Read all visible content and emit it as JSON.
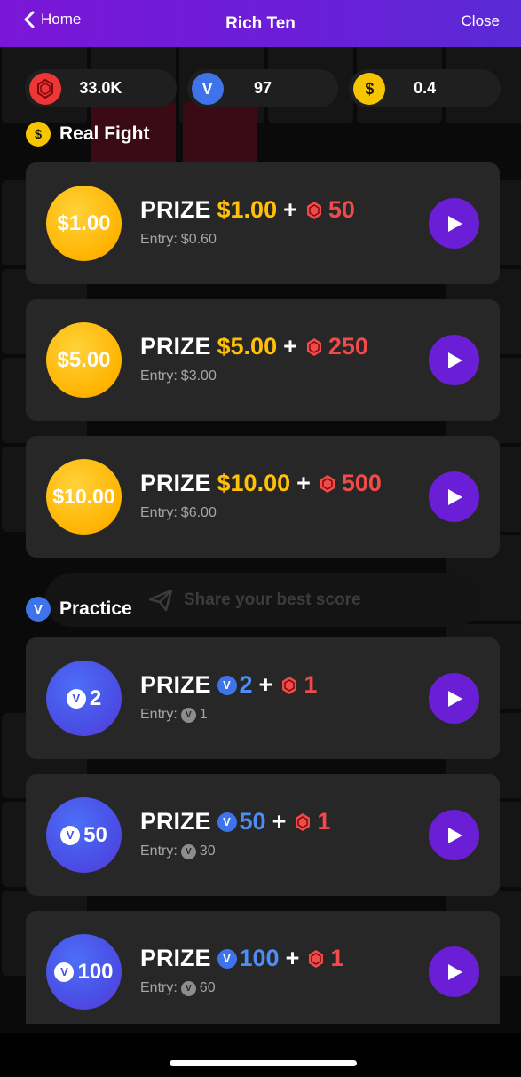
{
  "nav": {
    "back_label": "Home",
    "title": "Rich Ten",
    "close_label": "Close"
  },
  "stats": [
    {
      "icon": "gem-icon",
      "value": "33.0K"
    },
    {
      "icon": "v-coin-icon",
      "icon_text": "V",
      "value": "97"
    },
    {
      "icon": "dollar-coin-icon",
      "icon_text": "$",
      "value": "0.4"
    }
  ],
  "real_fight": {
    "badge": "$",
    "title": "Real Fight",
    "cards": [
      {
        "coin_label": "$1.00",
        "prize_label": "PRIZE",
        "prize_amount": "$1.00",
        "plus": "+",
        "gem_amount": "50",
        "entry_label": "Entry:",
        "entry_value": "$0.60"
      },
      {
        "coin_label": "$5.00",
        "prize_label": "PRIZE",
        "prize_amount": "$5.00",
        "plus": "+",
        "gem_amount": "250",
        "entry_label": "Entry:",
        "entry_value": "$3.00"
      },
      {
        "coin_label": "$10.00",
        "prize_label": "PRIZE",
        "prize_amount": "$10.00",
        "plus": "+",
        "gem_amount": "500",
        "entry_label": "Entry:",
        "entry_value": "$6.00"
      }
    ]
  },
  "share": {
    "label": "Share your best score"
  },
  "practice": {
    "badge": "V",
    "title": "Practice",
    "cards": [
      {
        "coin_label": "2",
        "prize_label": "PRIZE",
        "prize_amount": "2",
        "plus": "+",
        "gem_amount": "1",
        "entry_label": "Entry:",
        "entry_value": "1"
      },
      {
        "coin_label": "50",
        "prize_label": "PRIZE",
        "prize_amount": "50",
        "plus": "+",
        "gem_amount": "1",
        "entry_label": "Entry:",
        "entry_value": "30"
      },
      {
        "coin_label": "100",
        "prize_label": "PRIZE",
        "prize_amount": "100",
        "plus": "+",
        "gem_amount": "1",
        "entry_label": "Entry:",
        "entry_value": "60"
      }
    ]
  },
  "colors": {
    "nav_purple": "#6a1fd6",
    "gold": "#ffc107",
    "gem_red": "#f04a4a",
    "v_blue": "#3f73ea",
    "card_bg": "#272727"
  }
}
